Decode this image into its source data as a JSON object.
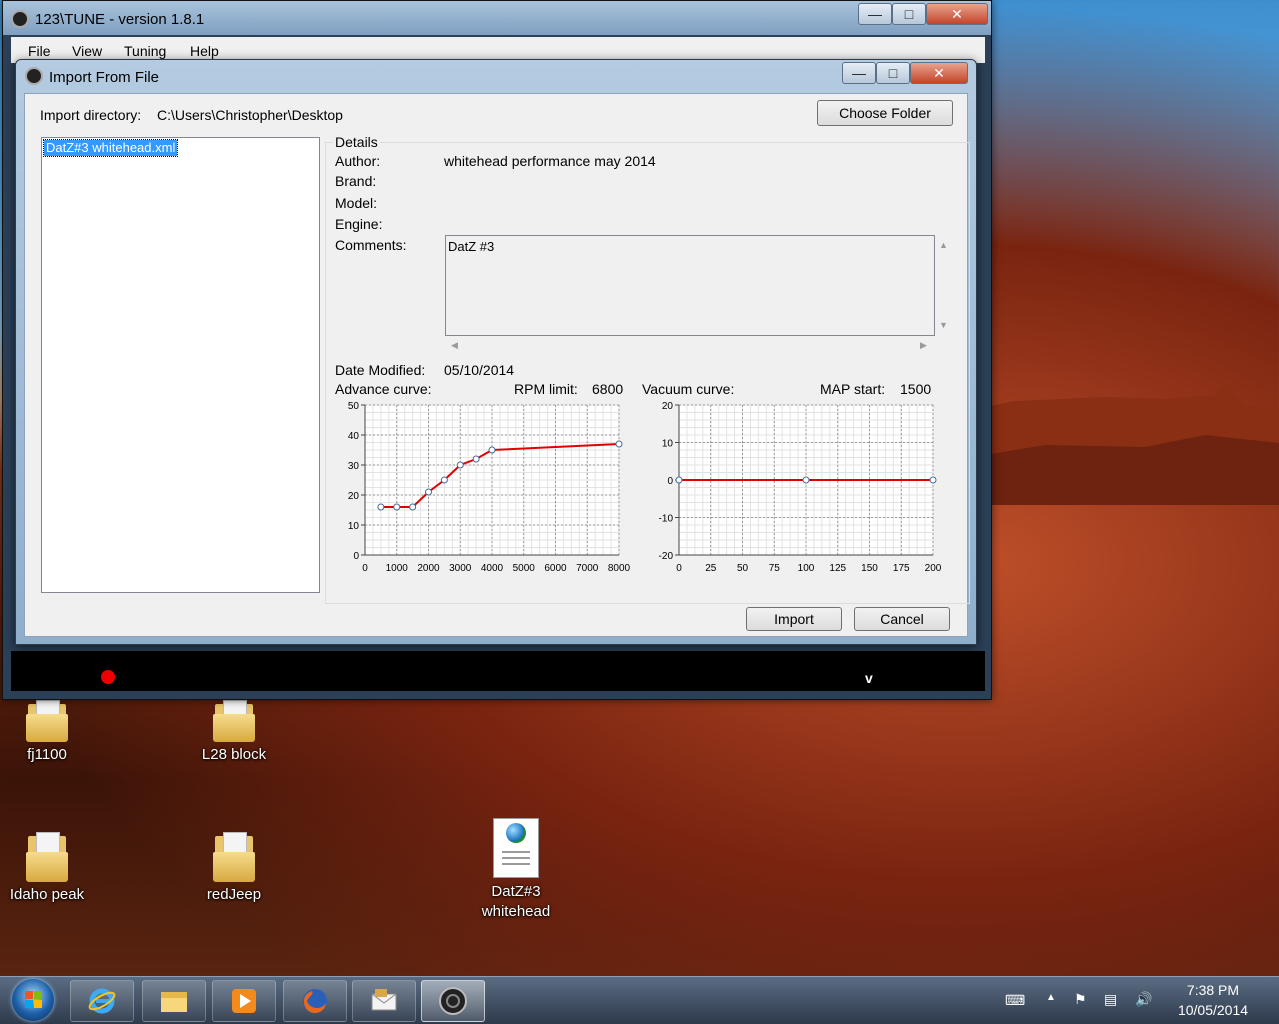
{
  "main_window": {
    "title": "123\\TUNE - version 1.8.1",
    "menu": [
      "File",
      "View",
      "Tuning",
      "Help"
    ],
    "bottom_glyph": "v"
  },
  "dialog": {
    "title": "Import From File",
    "import_dir_label": "Import directory:",
    "import_dir_value": "C:\\Users\\Christopher\\Desktop",
    "choose_folder_label": "Choose Folder",
    "files": [
      "DatZ#3 whitehead.xml"
    ],
    "details": {
      "group_label": "Details",
      "author_label": "Author:",
      "author_value": "whitehead performance may 2014",
      "brand_label": "Brand:",
      "model_label": "Model:",
      "engine_label": "Engine:",
      "comments_label": "Comments:",
      "comments_value": "DatZ #3",
      "date_modified_label": "Date Modified:",
      "date_modified_value": "05/10/2014",
      "advance_curve_label": "Advance curve:",
      "rpm_limit_label": "RPM limit:",
      "rpm_limit_value": "6800",
      "vacuum_curve_label": "Vacuum curve:",
      "map_start_label": "MAP start:",
      "map_start_value": "1500"
    },
    "import_label": "Import",
    "cancel_label": "Cancel"
  },
  "chart_data": [
    {
      "type": "line",
      "title": "Advance curve",
      "x": [
        500,
        1000,
        1500,
        2000,
        2500,
        3000,
        3500,
        4000,
        8000
      ],
      "y": [
        16,
        16,
        16,
        21,
        25,
        30,
        32,
        35,
        37
      ],
      "xlim": [
        0,
        8000
      ],
      "ylim": [
        0,
        50
      ],
      "xticks": [
        "0",
        "1000",
        "2000",
        "3000",
        "4000",
        "5000",
        "6000",
        "7000",
        "8000"
      ],
      "yticks": [
        "0",
        "10",
        "20",
        "30",
        "40",
        "50"
      ],
      "line_color": "#e00000",
      "grid": true
    },
    {
      "type": "line",
      "title": "Vacuum curve",
      "x": [
        0,
        100,
        200
      ],
      "y": [
        0,
        0,
        0
      ],
      "xlim": [
        0,
        200
      ],
      "ylim": [
        -20,
        20
      ],
      "xticks": [
        "0",
        "25",
        "50",
        "75",
        "100",
        "125",
        "150",
        "175",
        "200"
      ],
      "yticks": [
        "-20",
        "-10",
        "0",
        "10",
        "20"
      ],
      "line_color": "#e00000",
      "grid": true
    }
  ],
  "desktop_icons": [
    {
      "label": "fj1100",
      "kind": "folder"
    },
    {
      "label": "L28 block",
      "kind": "folder"
    },
    {
      "label": "Idaho peak",
      "kind": "folder"
    },
    {
      "label": "redJeep",
      "kind": "folder"
    },
    {
      "label": "DatZ#3 whitehead",
      "kind": "xml-document"
    }
  ],
  "taskbar": {
    "pinned": [
      "internet-explorer-icon",
      "windows-explorer-icon",
      "media-player-icon",
      "firefox-icon",
      "outlook-icon",
      "123tune-icon"
    ],
    "clock_time": "7:38 PM",
    "clock_date": "10/05/2014"
  }
}
